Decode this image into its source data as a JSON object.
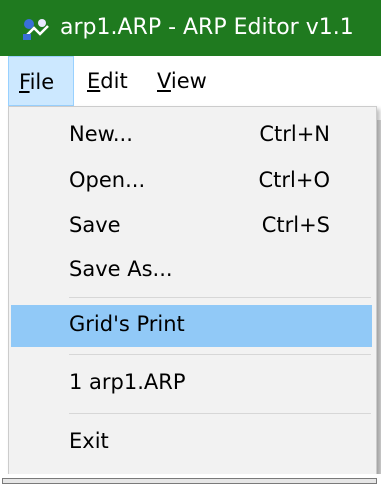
{
  "window": {
    "title": "arp1.ARP - ARP Editor v1.1",
    "titlebar_color": "#1f7a1f",
    "icon": "app-icon"
  },
  "menubar": {
    "file": {
      "accel": "F",
      "rest": "ile"
    },
    "edit": {
      "accel": "E",
      "rest": "dit"
    },
    "view": {
      "accel": "V",
      "rest": "iew"
    }
  },
  "file_menu": {
    "items": [
      {
        "label": "New...",
        "shortcut": "Ctrl+N"
      },
      {
        "label": "Open...",
        "shortcut": "Ctrl+O"
      },
      {
        "label": "Save",
        "shortcut": "Ctrl+S"
      },
      {
        "label": "Save As...",
        "shortcut": ""
      },
      {
        "label": "Grid's Print",
        "shortcut": "",
        "highlighted": true
      },
      {
        "label": "1 arp1.ARP",
        "shortcut": ""
      },
      {
        "label": "Exit",
        "shortcut": ""
      }
    ],
    "highlight_color": "#91c9f7"
  }
}
